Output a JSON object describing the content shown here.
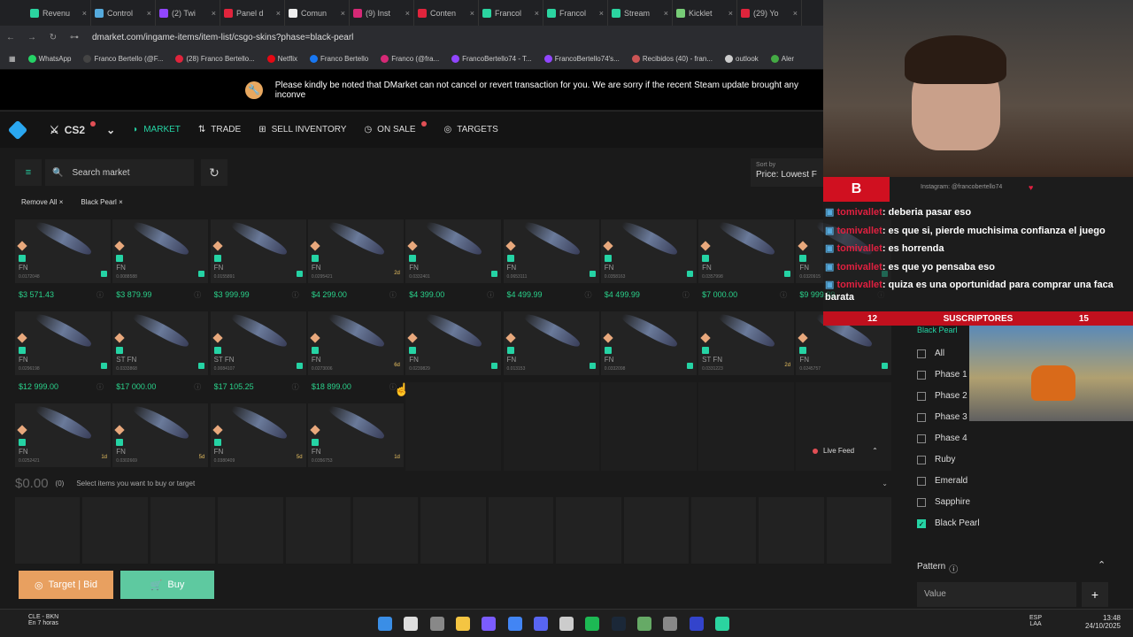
{
  "browser": {
    "tabs": [
      "Revenu",
      "Control",
      "(2) Twi",
      "Panel d",
      "Comun",
      "(9) Inst",
      "Conten",
      "Francol",
      "Francol",
      "Stream",
      "Kicklet",
      "(29) Yo"
    ],
    "url": "dmarket.com/ingame-items/item-list/csgo-skins?phase=black-pearl"
  },
  "bookmarks": [
    "WhatsApp",
    "Franco Bertello (@F...",
    "(28) Franco Bertello...",
    "Netflix",
    "Franco Bertello",
    "Franco (@fra...",
    "FrancoBertello74 - T...",
    "FrancoBertello74's...",
    "Recibidos (40) - fran...",
    "outlook",
    "Aler"
  ],
  "notice": "Please kindly be noted that DMarket can not cancel or revert transaction for you. We are sorry if the recent Steam update brought any inconve",
  "nav": {
    "game": "CS2",
    "market": "MARKET",
    "trade": "TRADE",
    "sell": "SELL INVENTORY",
    "onsale": "ON SALE",
    "targets": "TARGETS"
  },
  "search_placeholder": "Search market",
  "sort": {
    "label": "Sort by",
    "value": "Price: Lowest F"
  },
  "chips": {
    "remove": "Remove All",
    "filter": "Black Pearl"
  },
  "row1": [
    {
      "c": "FN",
      "f": "0.0172048"
    },
    {
      "c": "FN",
      "f": "0.0088588"
    },
    {
      "c": "FN",
      "f": "0.0155891"
    },
    {
      "c": "FN",
      "f": "0.0295421",
      "t": "2d"
    },
    {
      "c": "FN",
      "f": "0.0332401"
    },
    {
      "c": "FN",
      "f": "0.0653111"
    },
    {
      "c": "FN",
      "f": "0.0358163"
    },
    {
      "c": "FN",
      "f": "0.0357998"
    },
    {
      "c": "FN",
      "f": "0.0320915"
    }
  ],
  "prices1": [
    "$3 571.43",
    "$3 879.99",
    "$3 999.99",
    "$4 299.00",
    "$4 399.00",
    "$4 499.99",
    "$4 499.99",
    "$7 000.00",
    "$9 999.99"
  ],
  "row2": [
    {
      "c": "FN",
      "f": "0.0296198"
    },
    {
      "c": "ST FN",
      "f": "0.0333868"
    },
    {
      "c": "ST FN",
      "f": "0.0084107"
    },
    {
      "c": "FN",
      "f": "0.0273006",
      "t": "6d"
    },
    {
      "c": "FN",
      "f": "0.0239829"
    },
    {
      "c": "FN",
      "f": "0.013153"
    },
    {
      "c": "FN",
      "f": "0.0332098"
    },
    {
      "c": "ST FN",
      "f": "0.0331223",
      "t": "2d"
    },
    {
      "c": "FN",
      "f": "0.0245757"
    }
  ],
  "prices2": [
    "$12 999.00",
    "$17 000.00",
    "$17 105.25",
    "$18 899.00"
  ],
  "row3": [
    {
      "c": "FN",
      "f": "0.0252421",
      "t": "1d"
    },
    {
      "c": "FN",
      "f": "0.0302669",
      "t": "5d"
    },
    {
      "c": "FN",
      "f": "0.0380409",
      "t": "5d"
    },
    {
      "c": "FN",
      "f": "0.0356753",
      "t": "1d"
    }
  ],
  "live_feed": "Live Feed",
  "total": {
    "amount": "$0.00",
    "count": "(0)",
    "hint": "Select items you want to buy or target"
  },
  "buttons": {
    "target": "Target | Bid",
    "buy": "Buy"
  },
  "filters": {
    "title": "Black Pearl",
    "options": [
      "All",
      "Phase 1",
      "Phase 2",
      "Phase 3",
      "Phase 4",
      "Ruby",
      "Emerald",
      "Sapphire",
      "Black Pearl"
    ],
    "pattern": "Pattern",
    "value_placeholder": "Value"
  },
  "chat": {
    "instagram": "Instagram: @francobertello74",
    "lines": [
      {
        "user": "tomivallet",
        "msg": ": deberia pasar eso"
      },
      {
        "user": "tomivallet",
        "msg": ": es que si, pierde muchisima confianza el juego"
      },
      {
        "user": "tomivallet",
        "msg": ": es horrenda"
      },
      {
        "user": "tomivallet",
        "msg": ": es que yo pensaba eso"
      },
      {
        "user": "tomivallet",
        "msg": ": quiza es una oportunidad para comprar una faca barata"
      }
    ]
  },
  "subs": {
    "left": "12",
    "label": "SUSCRIPTORES",
    "right": "15"
  },
  "taskbar": {
    "weather_title": "CLE - BKN",
    "weather_sub": "En 7 horas",
    "lang": "ESP LAA",
    "time": "13:48",
    "date": "24/10/2025"
  }
}
